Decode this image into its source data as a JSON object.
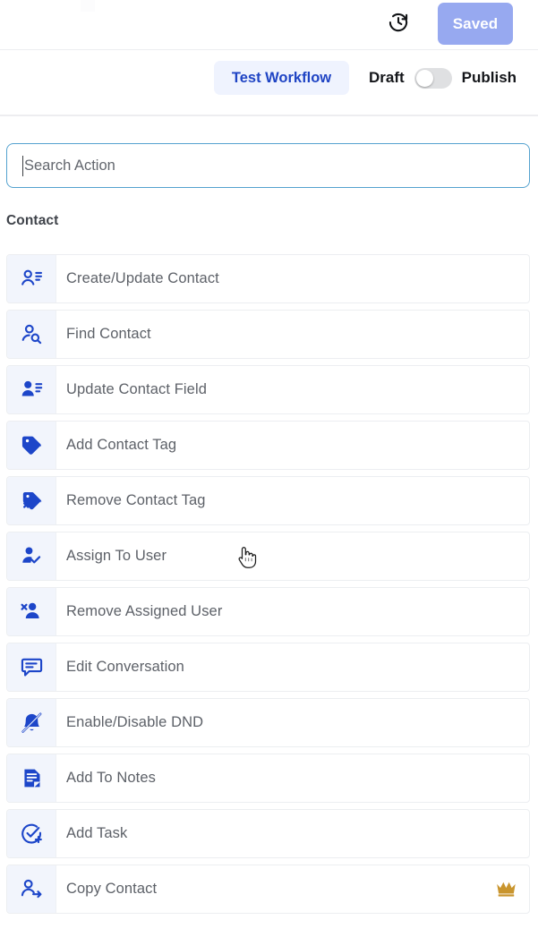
{
  "topbar": {
    "history_icon": "history-clock-icon",
    "saved_label": "Saved"
  },
  "actionbar": {
    "test_workflow_label": "Test Workflow",
    "draft_label": "Draft",
    "publish_label": "Publish",
    "toggle_state": "draft"
  },
  "search": {
    "placeholder": "Search Action",
    "value": ""
  },
  "section": {
    "title": "Contact"
  },
  "actions": [
    {
      "label": "Create/Update Contact",
      "icon": "person-lines-outline-icon",
      "badge": ""
    },
    {
      "label": "Find Contact",
      "icon": "person-search-icon",
      "badge": ""
    },
    {
      "label": "Update Contact Field",
      "icon": "person-lines-filled-icon",
      "badge": ""
    },
    {
      "label": "Add Contact Tag",
      "icon": "tag-icon",
      "badge": ""
    },
    {
      "label": "Remove Contact Tag",
      "icon": "tag-remove-icon",
      "badge": ""
    },
    {
      "label": "Assign To User",
      "icon": "person-check-icon",
      "badge": ""
    },
    {
      "label": "Remove Assigned User",
      "icon": "person-remove-icon",
      "badge": ""
    },
    {
      "label": "Edit Conversation",
      "icon": "chat-edit-icon",
      "badge": ""
    },
    {
      "label": "Enable/Disable DND",
      "icon": "bell-slash-icon",
      "badge": ""
    },
    {
      "label": "Add To Notes",
      "icon": "note-icon",
      "badge": ""
    },
    {
      "label": "Add Task",
      "icon": "check-circle-plus-icon",
      "badge": ""
    },
    {
      "label": "Copy Contact",
      "icon": "person-arrow-icon",
      "badge": "crown-icon"
    }
  ],
  "colors": {
    "icon_blue": "#1d46c9",
    "saved_bg": "#97a9f0",
    "test_workflow_bg": "#eff3fe",
    "test_workflow_text": "#1f44c4",
    "icon_cell_bg": "#f2f5fc",
    "crown_gold": "#c9952e",
    "search_border": "#54a2cf"
  }
}
